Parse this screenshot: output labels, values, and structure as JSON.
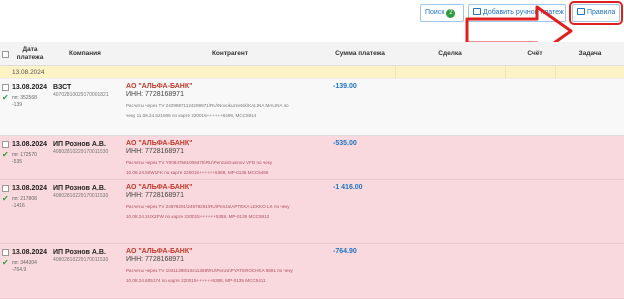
{
  "toolbar": {
    "search_label": "Поиск",
    "search_count": "2",
    "add_label": "Добавить ручной платеж",
    "rules_label": "Правила"
  },
  "table": {
    "columns": [
      "Дата платежа",
      "Компания",
      "Контрагент",
      "Сумма платежа",
      "Сделка",
      "Счёт",
      "Задача"
    ],
    "group_date": "13.08.2024",
    "rows": [
      {
        "date": "13.08.2024",
        "num": "пп: 352568",
        "num2": "-139",
        "company": "ВЗСТ",
        "company_inn": "40702810029170001821",
        "kontragent": "АО \"АЛЬФА-БАНК\"",
        "kontragent_inn": "ИНН: 7728168971",
        "desc1": "Расчеты через TV 24299871124299871\\RU\\Novokuznetsk\\KALINA MALINA по",
        "desc2": "чеку 11.08.24.521608 по карте 220015++++++6499, MCC5814",
        "sum": "-139.00",
        "style": "white"
      },
      {
        "date": "13.08.2024",
        "num": "пп: 172570",
        "num2": "-535",
        "company": "ИП Рознов А.В.",
        "company_inn": "40802810229170011530",
        "kontragent": "АО \"АЛЬФА-БАНК\"",
        "kontragent_inn": "ИНН: 7728168971",
        "desc1": "Расчеты через TV Y00847581008475\\RU\\Penza\\Gusinov VFD по чеку",
        "desc2": "10.08.24.50W1FK по карте 220015++++++5388, MP-0135 MCC5499",
        "sum": "-535.00",
        "style": "pink"
      },
      {
        "date": "13.08.2024",
        "num": "пп: 217808",
        "num2": "-1416",
        "company": "ИП Рознов А.В.",
        "company_inn": "40802810229170011530",
        "kontragent": "АО \"АЛЬФА-БАНК\"",
        "kontragent_inn": "ИНН: 7728168971",
        "desc1": "Расчеты через TV 24978291\\24978291\\RU\\Penza\\APTEKA LEKKO LK по чеку",
        "desc2": "10.08.24.3UX2FW по карте 220015++++++5388, MP-0135 MCC5912",
        "sum": "-1 416.00",
        "style": "pink"
      },
      {
        "date": "13.08.2024",
        "num": "пп: 344304",
        "num2": "-764.9",
        "company": "ИП Рознов А.В.",
        "company_inn": "40802810229170011530",
        "kontragent": "АО \"АЛЬФА-БАНК\"",
        "kontragent_inn": "ИНН: 7728168971",
        "desc1": "Расчеты через TV 10411388\\10411388\\RU\\Penza\\PYATEROCHKA 5891 по чеку",
        "desc2": "10.08.24.605174 по карте 220015++++++5388, MP-0135 MCC5411",
        "sum": "-764.90",
        "style": "pink"
      }
    ]
  },
  "colors": {
    "accent": "#1f74c4",
    "highlight_row": "#f9d9de",
    "group_bg": "#fdf3c4",
    "arrow": "#e02020"
  }
}
